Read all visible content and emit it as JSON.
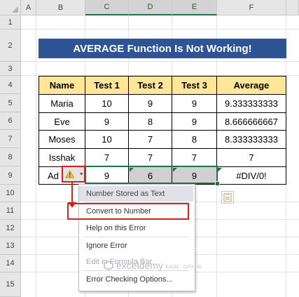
{
  "columns": [
    "A",
    "B",
    "C",
    "D",
    "E",
    "F"
  ],
  "rows": [
    "1",
    "2",
    "3",
    "4",
    "5",
    "6",
    "7",
    "8",
    "9",
    "10",
    "11",
    "12",
    "13",
    "14",
    "15"
  ],
  "title": "AVERAGE Function Is Not Working!",
  "table": {
    "headers": [
      "Name",
      "Test 1",
      "Test 2",
      "Test 3",
      "Average"
    ],
    "rows": [
      [
        "Maria",
        "10",
        "9",
        "9",
        "9.333333333"
      ],
      [
        "Eve",
        "9",
        "8",
        "9",
        "8.666666667"
      ],
      [
        "Moses",
        "10",
        "7",
        "8",
        "8.333333333"
      ],
      [
        "Isshak",
        "7",
        "7",
        "7",
        "7"
      ],
      [
        "Ad",
        "9",
        "6",
        "9",
        "#DIV/0!"
      ]
    ]
  },
  "error_menu": {
    "items": [
      "Number Stored as Text",
      "Convert to Number",
      "Help on this Error",
      "Ignore Error",
      "Edit in Formula Bar",
      "Error Checking Options..."
    ]
  },
  "watermark": {
    "brand": "exceldemy",
    "tagline": "EXCEL · DATA · BI"
  },
  "colors": {
    "title_bg": "#2f5496",
    "header_bg": "#ffe699",
    "highlight": "#d42020",
    "excel_green": "#217346"
  },
  "icons": {
    "error_indicator": "warning-triangle-icon",
    "dropdown": "dropdown-arrow-icon",
    "paste_options": "paste-options-icon"
  }
}
